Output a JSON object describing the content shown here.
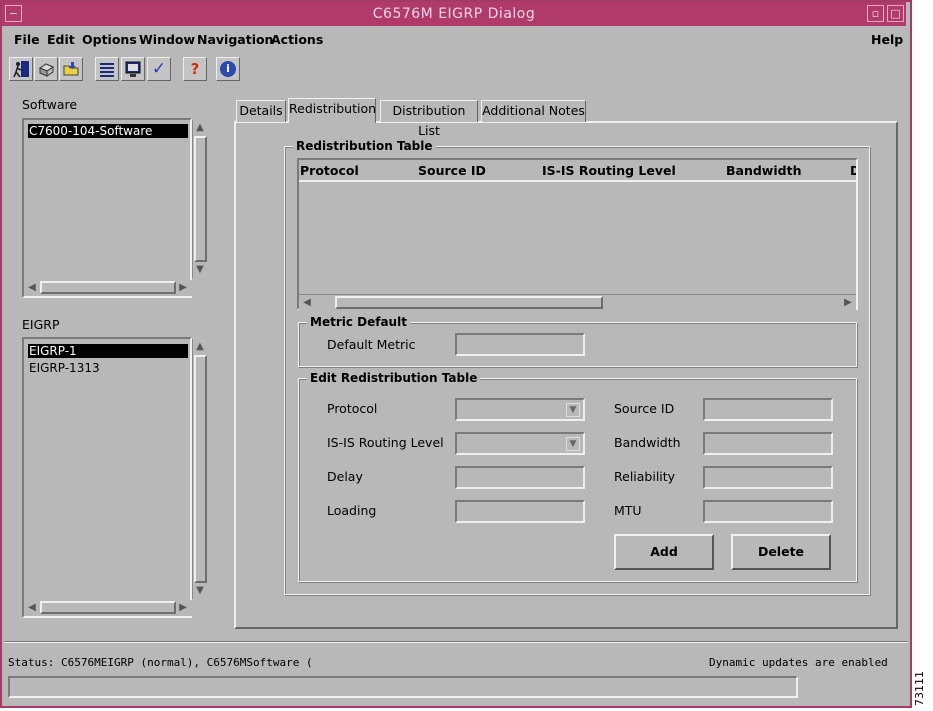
{
  "window": {
    "title": "C6576M EIGRP Dialog",
    "title_color": "#b03a6a",
    "minimize_glyph": "−",
    "restore_glyph": "▫",
    "maximize_glyph": "□"
  },
  "menu": {
    "file": "File",
    "edit": "Edit",
    "options": "Options",
    "window": "Window",
    "navigation": "Navigation",
    "actions": "Actions",
    "help": "Help"
  },
  "toolbar": {
    "icons": [
      "exit-icon",
      "print-icon",
      "open-folder-icon",
      "list-icon",
      "monitor-icon",
      "checkmark-icon",
      "help-question-icon",
      "info-icon"
    ],
    "glyph_help": "?",
    "glyph_info": "i",
    "glyph_check": "✓"
  },
  "left": {
    "software_label": "Software",
    "software_items": [
      "C7600-104-Software"
    ],
    "eigrp_label": "EIGRP",
    "eigrp_items": [
      "EIGRP-1",
      "EIGRP-1313"
    ]
  },
  "tabs": {
    "details": "Details",
    "redistribution": "Redistribution",
    "distribution_list": "Distribution List",
    "additional_notes": "Additional Notes",
    "active": "Redistribution"
  },
  "redistribution_table": {
    "title": "Redistribution Table",
    "columns": [
      "Protocol",
      "Source ID",
      "IS-IS Routing Level",
      "Bandwidth",
      "D"
    ],
    "rows": []
  },
  "metric_default": {
    "title": "Metric Default",
    "default_metric_label": "Default Metric",
    "default_metric_value": ""
  },
  "edit_table": {
    "title": "Edit Redistribution Table",
    "protocol_label": "Protocol",
    "protocol_value": "",
    "isis_label": "IS-IS Routing Level",
    "isis_value": "",
    "delay_label": "Delay",
    "delay_value": "",
    "loading_label": "Loading",
    "loading_value": "",
    "source_id_label": "Source ID",
    "source_id_value": "",
    "bandwidth_label": "Bandwidth",
    "bandwidth_value": "",
    "reliability_label": "Reliability",
    "reliability_value": "",
    "mtu_label": "MTU",
    "mtu_value": "",
    "add_label": "Add",
    "delete_label": "Delete"
  },
  "status": {
    "left": "Status: C6576MEIGRP (normal), C6576MSoftware (",
    "right": "Dynamic updates are enabled",
    "figure_number": "73111"
  }
}
